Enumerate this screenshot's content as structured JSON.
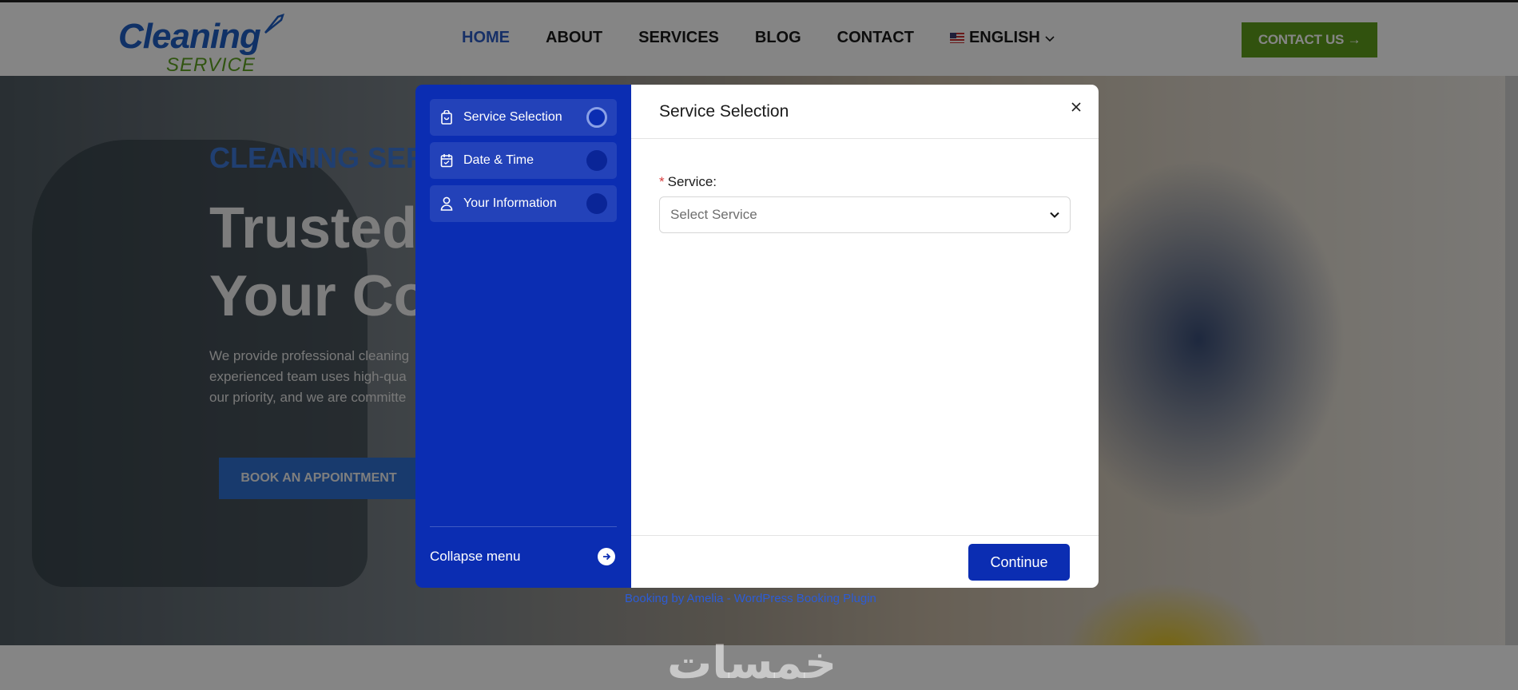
{
  "header": {
    "logo_line1": "Cleaning",
    "logo_line2": "SERVICE",
    "nav": [
      {
        "label": "HOME"
      },
      {
        "label": "ABOUT"
      },
      {
        "label": "SERVICES"
      },
      {
        "label": "BLOG"
      },
      {
        "label": "CONTACT"
      }
    ],
    "language": "ENGLISH",
    "contact_button": "CONTACT US →",
    "colors": {
      "brand_blue": "#2c5cc5",
      "brand_green": "#5f9e1c"
    }
  },
  "hero": {
    "tagline": "CLEANING SERV",
    "headline_line1": "Trusted E",
    "headline_line2": "Your Com",
    "paragraph_lines": [
      "We provide professional cleaning",
      "experienced team uses high-qua",
      "our priority, and we are committe"
    ],
    "book_button": "BOOK AN APPOINTMENT"
  },
  "modal": {
    "steps": [
      {
        "label": "Service Selection",
        "icon": "shopping-bag-icon",
        "state": "current"
      },
      {
        "label": "Date & Time",
        "icon": "calendar-icon",
        "state": "pending"
      },
      {
        "label": "Your Information",
        "icon": "user-icon",
        "state": "pending"
      }
    ],
    "collapse_label": "Collapse menu",
    "title": "Service Selection",
    "field_required_mark": "*",
    "field_label": "Service:",
    "select_placeholder": "Select Service",
    "continue_label": "Continue",
    "colors": {
      "sidebar": "#0b2db2",
      "primary": "#0b2db2"
    }
  },
  "footer": {
    "powered_by": "Booking by Amelia - WordPress Booking Plugin",
    "watermark": "خمسات"
  }
}
